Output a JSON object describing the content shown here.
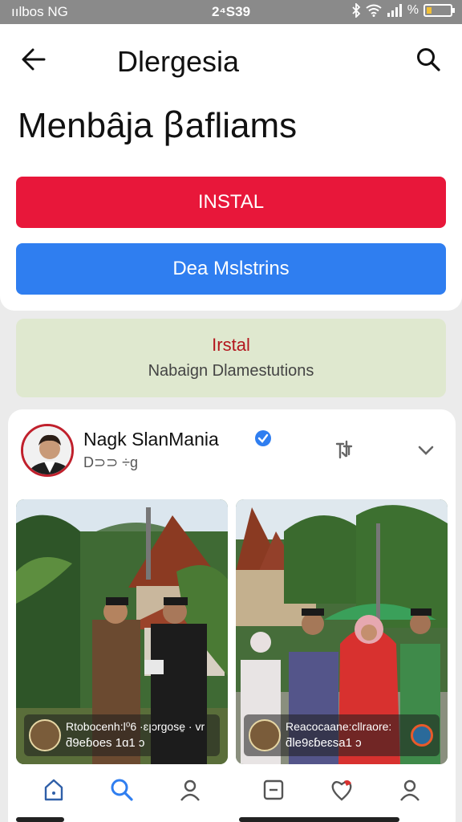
{
  "status_bar": {
    "carrier": "ıılbos NG",
    "time": "2⁴S39",
    "battery_level": 0.2,
    "icons": [
      "bluetooth-icon",
      "wifi-icon",
      "signal-icon",
      "battery-icon"
    ]
  },
  "header": {
    "app_title": "Dlergesia",
    "page_heading": "Menbȃja ꞵafliams",
    "back_icon": "arrow-left-icon",
    "search_icon": "search-icon"
  },
  "actions": {
    "primary_label": "INSTAL",
    "secondary_label": "Dea Mslstrins"
  },
  "banner": {
    "title": "Irstal",
    "subtitle": "Nabaign Dlamestutions"
  },
  "post": {
    "author": "Nagk SlanMania",
    "meta": "D⊃⊃ ÷g",
    "verified": true,
    "photos": [
      {
        "caption_line1": "Rtobocenh:l⁰6 ·ɛꞁɔrgose̱ · vr",
        "caption_line2": "ƌ9eɓoes 1ɑ1 ɔ"
      },
      {
        "caption_line1": "Reacocaane:cllraore:",
        "caption_line2": "ƌle9ɛɓeɛsa1 ɔ"
      }
    ],
    "nav_left": [
      "home-icon",
      "search-icon",
      "profile-icon"
    ],
    "nav_right": [
      "minus-icon",
      "heart-icon",
      "profile-icon"
    ]
  },
  "colors": {
    "install": "#e8173a",
    "details": "#2f7ef0",
    "banner_bg": "#dfe8cf",
    "banner_title": "#b3161d",
    "status_bar": "#8a8a8a",
    "verified": "#2f7ef0"
  }
}
